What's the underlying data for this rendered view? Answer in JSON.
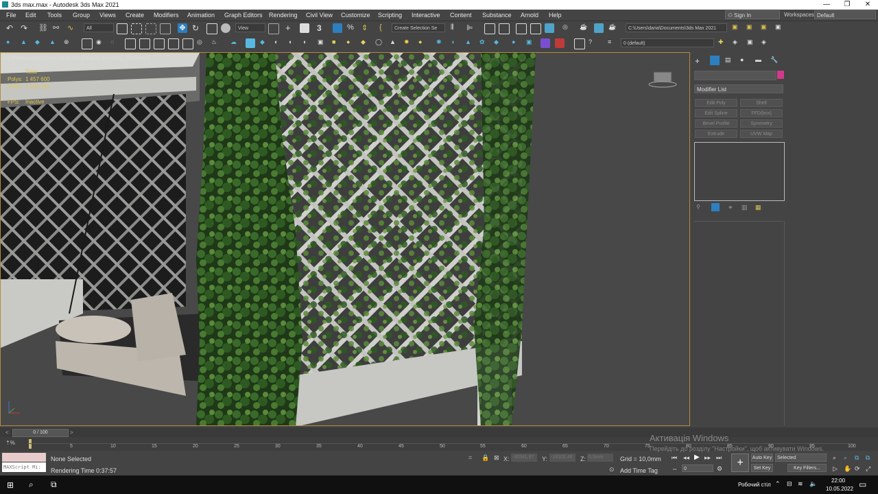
{
  "window": {
    "title": "3ds max.max - Autodesk 3ds Max 2021"
  },
  "menu": [
    "File",
    "Edit",
    "Tools",
    "Group",
    "Views",
    "Create",
    "Modifiers",
    "Animation",
    "Graph Editors",
    "Rendering",
    "Civil View",
    "Customize",
    "Scripting",
    "Interactive",
    "Content",
    "Substance",
    "Arnold",
    "Help"
  ],
  "signin": "Sign In",
  "workspaces": {
    "label": "Workspaces:",
    "value": "Default"
  },
  "toolbar": {
    "filter": "All",
    "view": "View",
    "selection_set": "Create Selection Se",
    "path": "C:\\Users\\daria\\Documents\\3ds Max 2021",
    "layer": "0 (default)"
  },
  "viewport": {
    "label": "[+] [Perspective] [User Defined] [Default Shading] [Standard]",
    "stats_total": "Total",
    "stats_polys_label": "Polys:",
    "stats_polys": "1 457 600",
    "stats_verts_label": "Verts:",
    "stats_verts": "1 791 320",
    "fps_label": "FPS:",
    "fps_value": "Inactive"
  },
  "command_panel": {
    "modifier_list": "Modifier List",
    "buttons": [
      "Edit Poly",
      "Shell",
      "Edit Spline",
      "FFD(box)",
      "Bevel Profile",
      "Symmetry",
      "Extrude",
      "UVW Map"
    ]
  },
  "timeline": {
    "frame": "0 / 100",
    "ticks": [
      "0",
      "5",
      "10",
      "15",
      "20",
      "25",
      "30",
      "35",
      "40",
      "45",
      "50",
      "55",
      "60",
      "65",
      "70",
      "75",
      "80",
      "85",
      "90",
      "95",
      "100"
    ]
  },
  "status": {
    "script_label": "MAXScript Mi:",
    "selection": "None Selected",
    "render_time": "Rendering Time  0:37:57",
    "x_label": "X:",
    "x_value": "-30341,87",
    "y_label": "Y:",
    "y_value": "-18102,46",
    "z_label": "Z:",
    "z_value": "0,0mm",
    "grid": "Grid = 10,0mm",
    "add_time_tag": "Add Time Tag",
    "auto_key": "Auto Key",
    "set_key": "Set Key",
    "selected": "Selected",
    "key_filters": "Key Filters...",
    "frame_field": "0"
  },
  "watermark": {
    "line1": "Активація Windows",
    "line2": "Перейдіть до розділу \"Настройки\", щоб активувати Windows."
  },
  "taskbar": {
    "desktop": "Робочий стіл",
    "time": "22:00",
    "date": "10.05.2022"
  },
  "colors": {
    "accent": "#2d7fc0",
    "viewport_border": "#b58c3c",
    "swatch": "#d13a8a",
    "stat_text": "#e0c850"
  }
}
